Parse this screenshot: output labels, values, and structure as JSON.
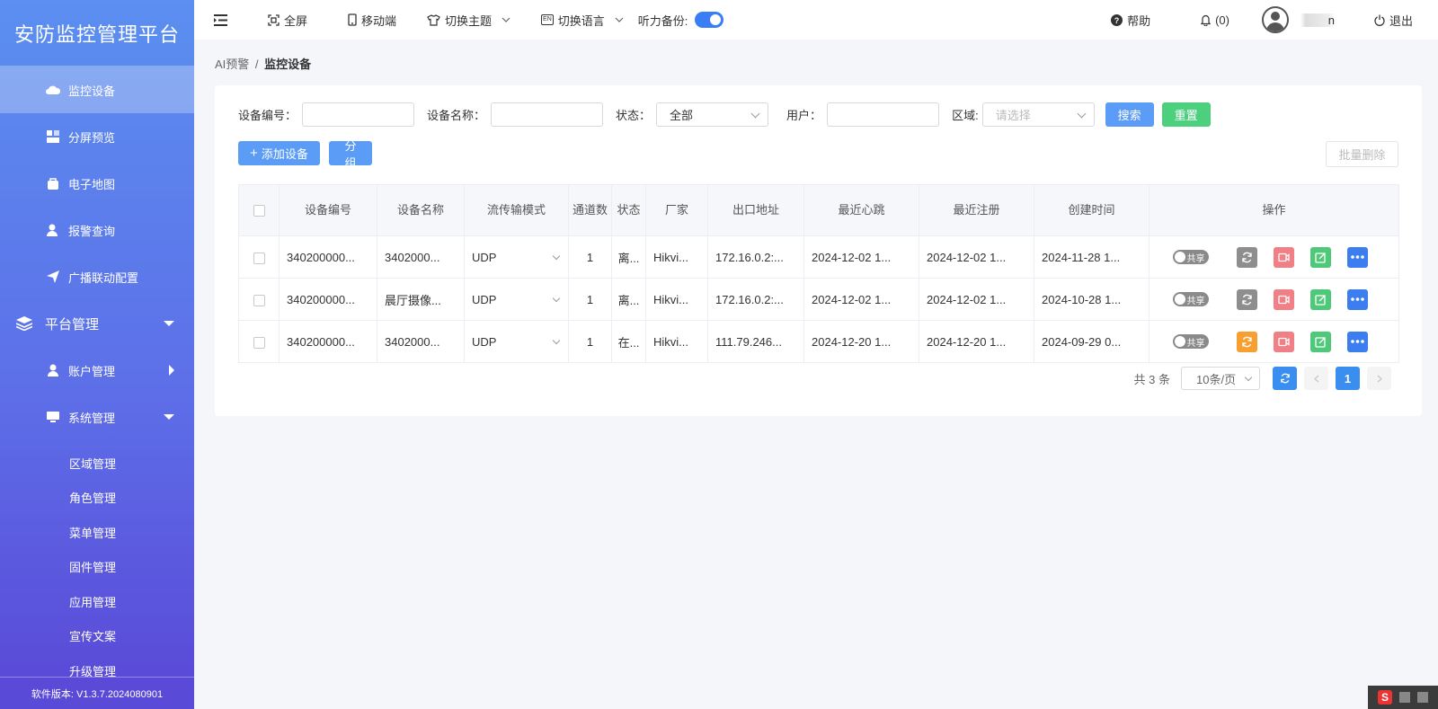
{
  "brand": "安防监控管理平台",
  "sidebar": {
    "items": [
      {
        "label": "监控设备",
        "icon": "cloud-icon"
      },
      {
        "label": "分屏预览",
        "icon": "split-screen-icon"
      },
      {
        "label": "电子地图",
        "icon": "map-bag-icon"
      },
      {
        "label": "报警查询",
        "icon": "user-alert-icon"
      },
      {
        "label": "广播联动配置",
        "icon": "send-icon"
      }
    ],
    "platform_group": "平台管理",
    "account_mgmt": "账户管理",
    "system_mgmt": "系统管理",
    "sub_items": [
      "区域管理",
      "角色管理",
      "菜单管理",
      "固件管理",
      "应用管理",
      "宣传文案",
      "升级管理"
    ],
    "version": "软件版本: V1.3.7.2024080901"
  },
  "topbar": {
    "fullscreen": "全屏",
    "mobile": "移动端",
    "theme": "切换主题",
    "language": "切换语言",
    "lang_badge": "EN",
    "backup_label": "听力备份:",
    "help": "帮助",
    "notifications": "(0)",
    "username": "n",
    "logout": "退出"
  },
  "breadcrumb": {
    "parent": "AI预警",
    "sep": "/",
    "current": "监控设备"
  },
  "filters": {
    "device_no_label": "设备编号：",
    "device_name_label": "设备名称：",
    "status_label": "状态：",
    "status_value": "全部",
    "user_label": "用户：",
    "region_label": "区域:",
    "region_placeholder": "请选择",
    "search_btn": "搜索",
    "reset_btn": "重置"
  },
  "actions": {
    "add_device": "添加设备",
    "group": "分组",
    "batch_delete": "批量删除"
  },
  "table": {
    "headers": [
      "设备编号",
      "设备名称",
      "流传输模式",
      "通道数",
      "状态",
      "厂家",
      "出口地址",
      "最近心跳",
      "最近注册",
      "创建时间",
      "操作"
    ],
    "rows": [
      {
        "id": "340200000...",
        "name": "3402000...",
        "mode": "UDP",
        "channels": "1",
        "status": "离...",
        "vendor": "Hikvi...",
        "addr": "172.16.0.2:...",
        "heartbeat": "2024-12-02 1...",
        "register": "2024-12-02 1...",
        "created": "2024-11-28 1...",
        "share": "共享"
      },
      {
        "id": "340200000...",
        "name": "晨厅摄像...",
        "mode": "UDP",
        "channels": "1",
        "status": "离...",
        "vendor": "Hikvi...",
        "addr": "172.16.0.2:...",
        "heartbeat": "2024-12-02 1...",
        "register": "2024-12-02 1...",
        "created": "2024-10-28 1...",
        "share": "共享"
      },
      {
        "id": "340200000...",
        "name": "3402000...",
        "mode": "UDP",
        "channels": "1",
        "status": "在...",
        "vendor": "Hikvi...",
        "addr": "111.79.246...",
        "heartbeat": "2024-12-20 1...",
        "register": "2024-12-20 1...",
        "created": "2024-09-29 0...",
        "share": "共享"
      }
    ]
  },
  "pagination": {
    "total": "共 3 条",
    "page_size": "10条/页",
    "current_page": "1"
  },
  "colors": {
    "primary": "#3a8ef0",
    "success": "#4cd07d",
    "danger": "#f07f86",
    "warning": "#f7a031"
  }
}
